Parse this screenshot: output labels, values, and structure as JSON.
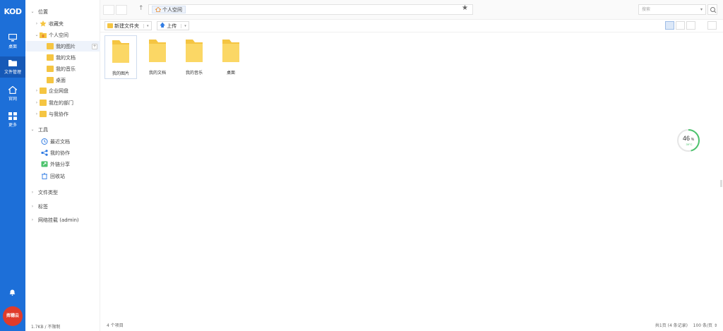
{
  "app": {
    "logo": "KOD",
    "nav": [
      {
        "label": "桌面",
        "icon": "monitor-icon"
      },
      {
        "label": "文件管理",
        "icon": "folder-icon"
      },
      {
        "label": "官网",
        "icon": "home-icon"
      },
      {
        "label": "更多",
        "icon": "grid-icon"
      }
    ],
    "badge": "挥穗云"
  },
  "sidebar": {
    "position_label": "位置",
    "favorites": "收藏夹",
    "personal_space": "个人空间",
    "children": [
      "我的图片",
      "我的文档",
      "我的音乐",
      "桌面"
    ],
    "enterprise_disk": "企业网盘",
    "my_department": "我在的部门",
    "collab_with_me": "与我协作",
    "tools_label": "工具",
    "tools": [
      "最近文档",
      "我的协作",
      "外链分享",
      "回收站"
    ],
    "file_type": "文件类型",
    "tags": "标签",
    "mount": "网络挂载 (admin)",
    "footer": "1.7KB / 不限制"
  },
  "topbar": {
    "breadcrumb": "个人空间",
    "search_placeholder": "搜索"
  },
  "toolbar": {
    "new_folder": "新建文件夹",
    "upload": "上传"
  },
  "files": [
    "我的图片",
    "我的文档",
    "我的音乐",
    "桌面"
  ],
  "status": {
    "count": "4 个项目",
    "pager": "共1页 (4 条记录)",
    "per_page": "100 条/页"
  },
  "widget": {
    "percent": "46",
    "percent_unit": "%",
    "temp": "39°C"
  },
  "colors": {
    "appbar": "#1d6fd8",
    "folder": "#f5c542",
    "gauge": "#4cc36d"
  }
}
